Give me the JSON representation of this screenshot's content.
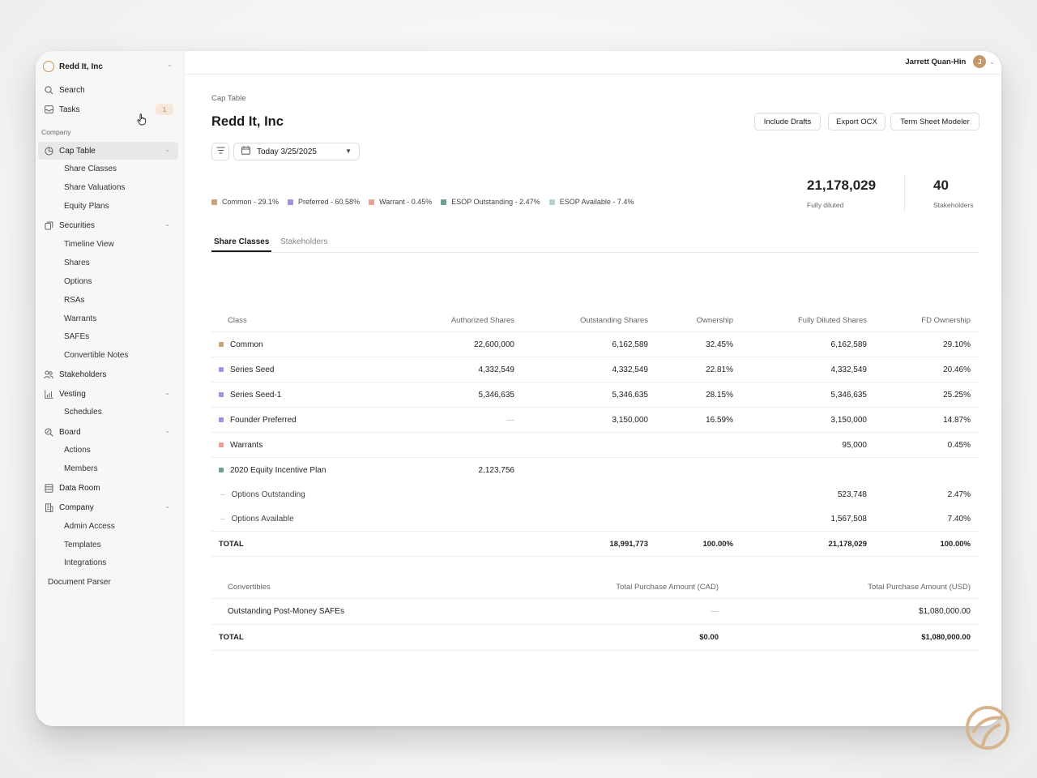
{
  "company": {
    "name": "Redd It, Inc"
  },
  "sidebar": {
    "search_label": "Search",
    "tasks_label": "Tasks",
    "tasks_badge": "1",
    "section_company": "Company",
    "cap_table": "Cap Table",
    "cap_table_items": [
      "Share Classes",
      "Share Valuations",
      "Equity Plans"
    ],
    "securities": "Securities",
    "securities_items": [
      "Timeline View",
      "Shares",
      "Options",
      "RSAs",
      "Warrants",
      "SAFEs",
      "Convertible Notes"
    ],
    "stakeholders": "Stakeholders",
    "vesting": "Vesting",
    "vesting_items": [
      "Schedules"
    ],
    "board": "Board",
    "board_items": [
      "Actions",
      "Members"
    ],
    "data_room": "Data Room",
    "company_group": "Company",
    "company_items": [
      "Admin Access",
      "Templates",
      "Integrations"
    ],
    "document_parser": "Document Parser"
  },
  "header": {
    "user_name": "Jarrett Quan-Hin",
    "avatar_initial": "J"
  },
  "page": {
    "breadcrumb": "Cap Table",
    "title": "Redd It, Inc",
    "buttons": {
      "include_drafts": "Include Drafts",
      "export_ocx": "Export OCX",
      "term_sheet": "Term Sheet Modeler"
    },
    "date_label": "Today 3/25/2025"
  },
  "legend": [
    {
      "label": "Common - 29.1%",
      "color": "#c9a47a"
    },
    {
      "label": "Preferred - 60.58%",
      "color": "#9b94e0"
    },
    {
      "label": "Warrant - 0.45%",
      "color": "#e8a194"
    },
    {
      "label": "ESOP Outstanding - 2.47%",
      "color": "#6f9f92"
    },
    {
      "label": "ESOP Available - 7.4%",
      "color": "#b8d3c6"
    }
  ],
  "stats": {
    "fully_diluted_value": "21,178,029",
    "fully_diluted_label": "Fully diluted",
    "stakeholders_value": "40",
    "stakeholders_label": "Stakeholders"
  },
  "tabs": {
    "share_classes": "Share Classes",
    "stakeholders": "Stakeholders"
  },
  "share_table": {
    "headers": {
      "class": "Class",
      "authorized": "Authorized Shares",
      "outstanding": "Outstanding Shares",
      "ownership": "Ownership",
      "fd_shares": "Fully Diluted Shares",
      "fd_ownership": "FD Ownership"
    },
    "rows": [
      {
        "name": "Common",
        "authorized": "22,600,000",
        "outstanding": "6,162,589",
        "ownership": "32.45%",
        "fd_shares": "6,162,589",
        "fd_ownership": "29.10%"
      },
      {
        "name": "Series Seed",
        "authorized": "4,332,549",
        "outstanding": "4,332,549",
        "ownership": "22.81%",
        "fd_shares": "4,332,549",
        "fd_ownership": "20.46%"
      },
      {
        "name": "Series Seed-1",
        "authorized": "5,346,635",
        "outstanding": "5,346,635",
        "ownership": "28.15%",
        "fd_shares": "5,346,635",
        "fd_ownership": "25.25%"
      },
      {
        "name": "Founder Preferred",
        "authorized": "—",
        "outstanding": "3,150,000",
        "ownership": "16.59%",
        "fd_shares": "3,150,000",
        "fd_ownership": "14.87%"
      },
      {
        "name": "Warrants",
        "authorized": "",
        "outstanding": "",
        "ownership": "",
        "fd_shares": "95,000",
        "fd_ownership": "0.45%"
      },
      {
        "name": "2020 Equity Incentive Plan",
        "authorized": "2,123,756",
        "outstanding": "",
        "ownership": "",
        "fd_shares": "",
        "fd_ownership": ""
      },
      {
        "name": "Options Outstanding",
        "authorized": "",
        "outstanding": "",
        "ownership": "",
        "fd_shares": "523,748",
        "fd_ownership": "2.47%"
      },
      {
        "name": "Options Available",
        "authorized": "",
        "outstanding": "",
        "ownership": "",
        "fd_shares": "1,567,508",
        "fd_ownership": "7.40%"
      }
    ],
    "total": {
      "label": "TOTAL",
      "outstanding": "18,991,773",
      "ownership": "100.00%",
      "fd_shares": "21,178,029",
      "fd_ownership": "100.00%"
    }
  },
  "convertibles_table": {
    "headers": {
      "name": "Convertibles",
      "cad": "Total Purchase Amount (CAD)",
      "usd": "Total Purchase Amount (USD)"
    },
    "rows": [
      {
        "name": "Outstanding Post-Money SAFEs",
        "cad": "—",
        "usd": "$1,080,000.00"
      }
    ],
    "total": {
      "label": "TOTAL",
      "cad": "$0.00",
      "usd": "$1,080,000.00"
    }
  }
}
